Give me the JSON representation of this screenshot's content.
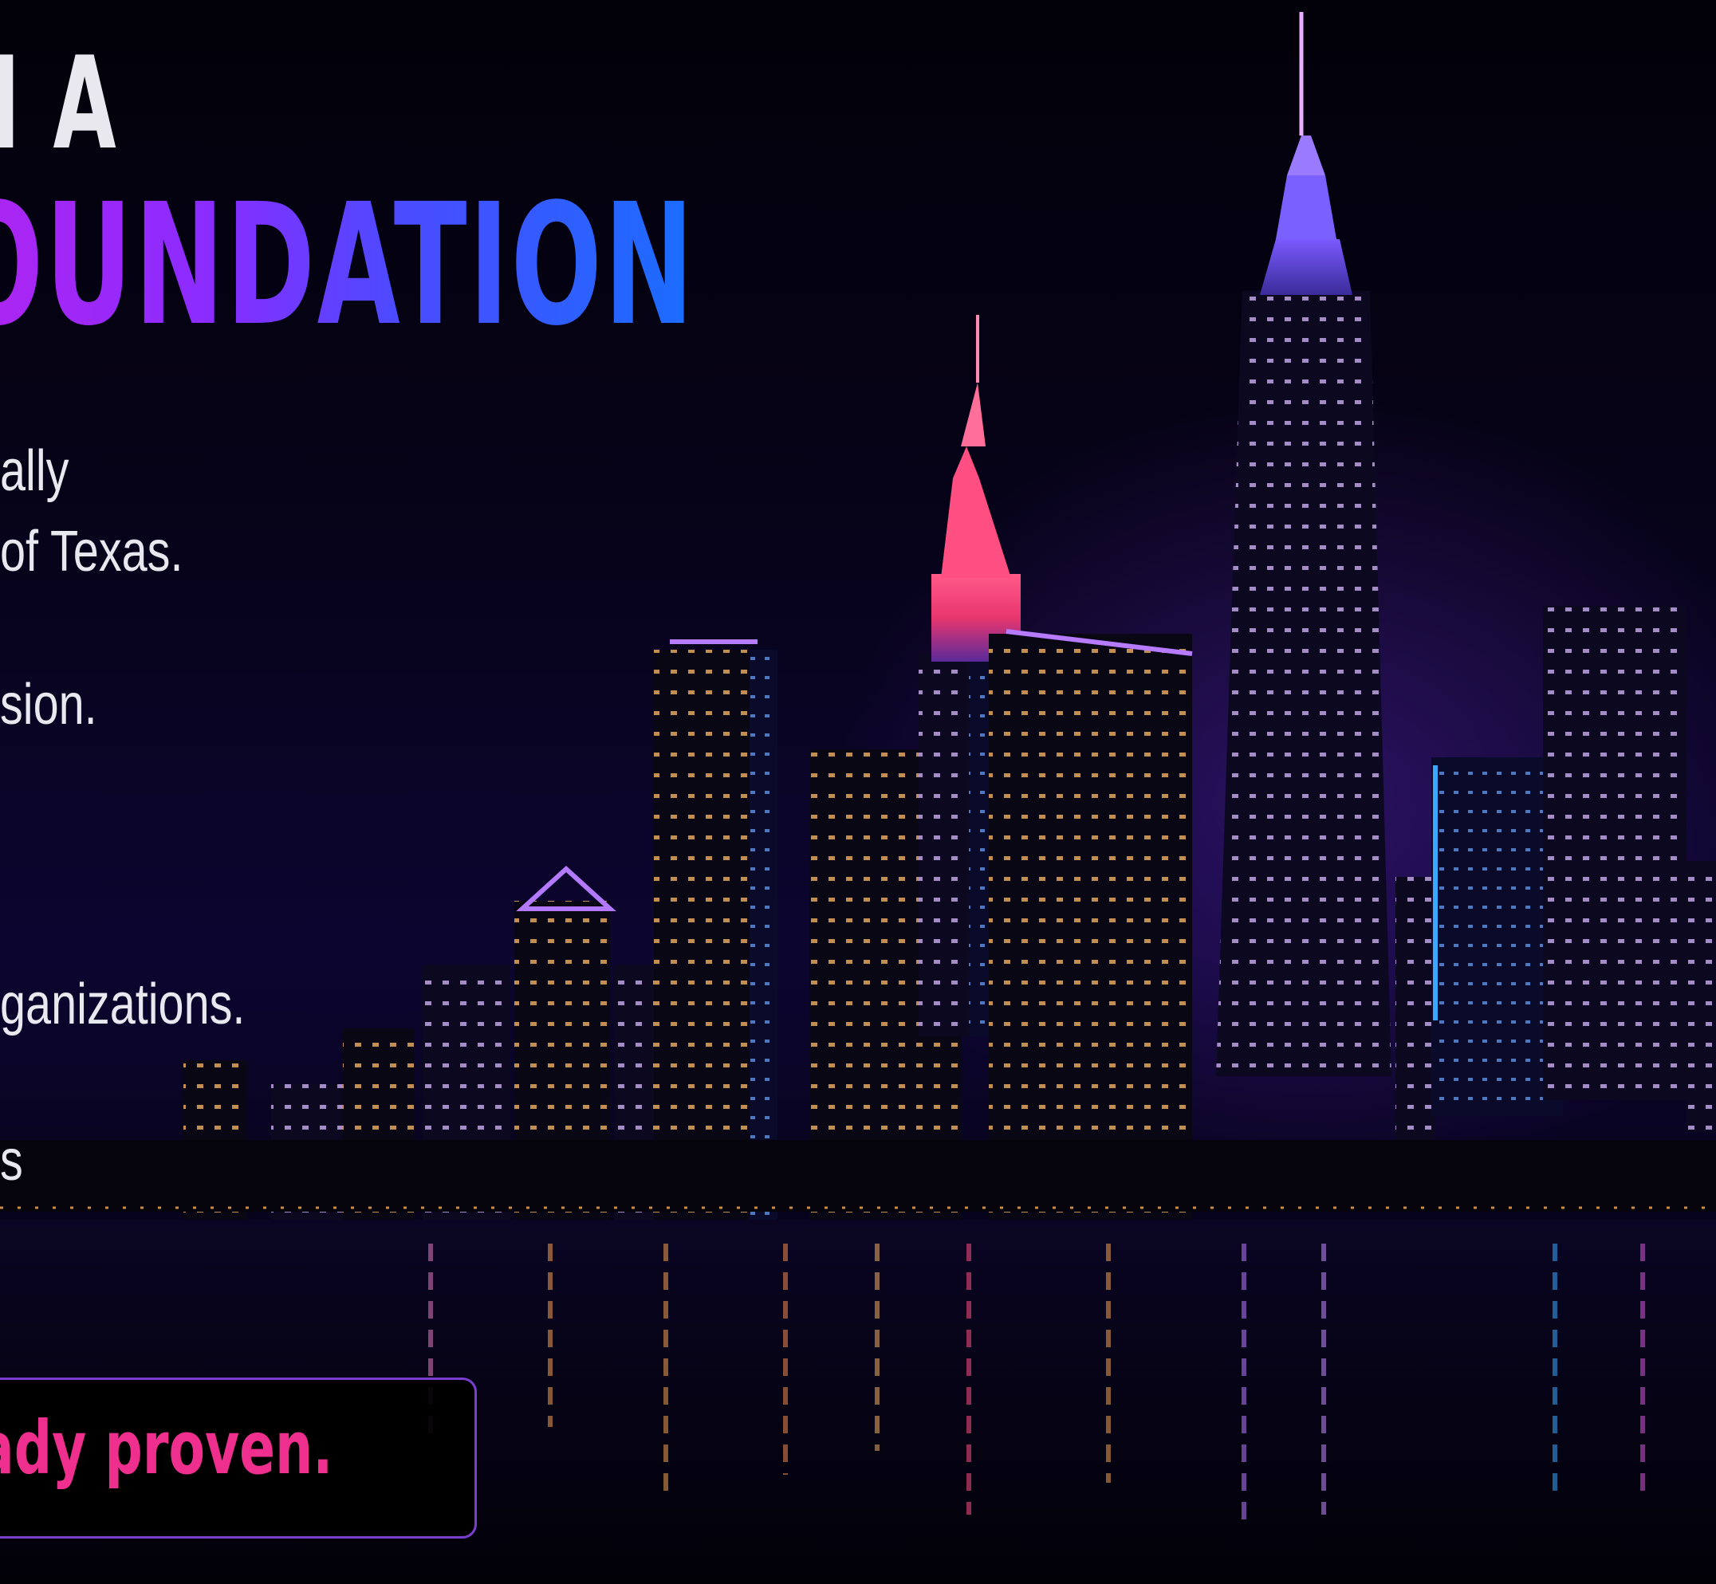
{
  "headline": {
    "line1": "N A",
    "line2": "OUNDATION"
  },
  "body": {
    "lines": [
      "ally",
      "of Texas.",
      "sion.",
      "ganizations.",
      "s"
    ]
  },
  "callout": {
    "text": "ady proven."
  },
  "colors": {
    "background": "#05020f",
    "headline_white": "#e8e8ee",
    "headline_gradient_start": "#b224f0",
    "headline_gradient_end": "#1a6dff",
    "callout_text": "#ee2f8e",
    "callout_border": "#7b3fd0"
  }
}
